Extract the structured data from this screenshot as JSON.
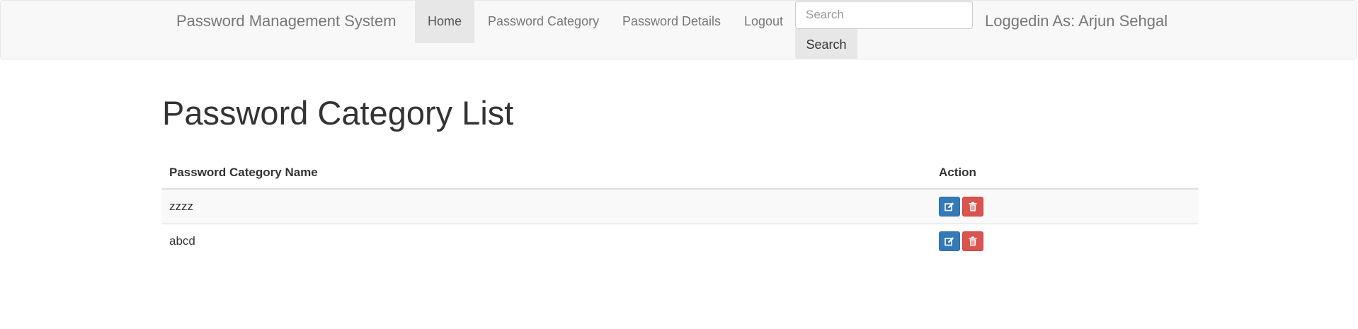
{
  "navbar": {
    "brand": "Password Management System",
    "items": [
      {
        "label": "Home",
        "active": true
      },
      {
        "label": "Password Category",
        "active": false
      },
      {
        "label": "Password Details",
        "active": false
      },
      {
        "label": "Logout",
        "active": false
      }
    ],
    "search": {
      "placeholder": "Search",
      "value": "",
      "button_label": "Search"
    },
    "logged_in": "Loggedin As: Arjun Sehgal"
  },
  "page": {
    "title": "Password Category List"
  },
  "table": {
    "columns": [
      "Password Category Name",
      "Action"
    ],
    "rows": [
      {
        "name": "zzzz"
      },
      {
        "name": "abcd"
      }
    ]
  },
  "icons": {
    "edit": "edit-icon",
    "delete": "trash-icon"
  },
  "colors": {
    "edit_button": "#337ab7",
    "delete_button": "#d9534f",
    "navbar_bg": "#f8f8f8",
    "active_nav_bg": "#e7e7e7"
  }
}
